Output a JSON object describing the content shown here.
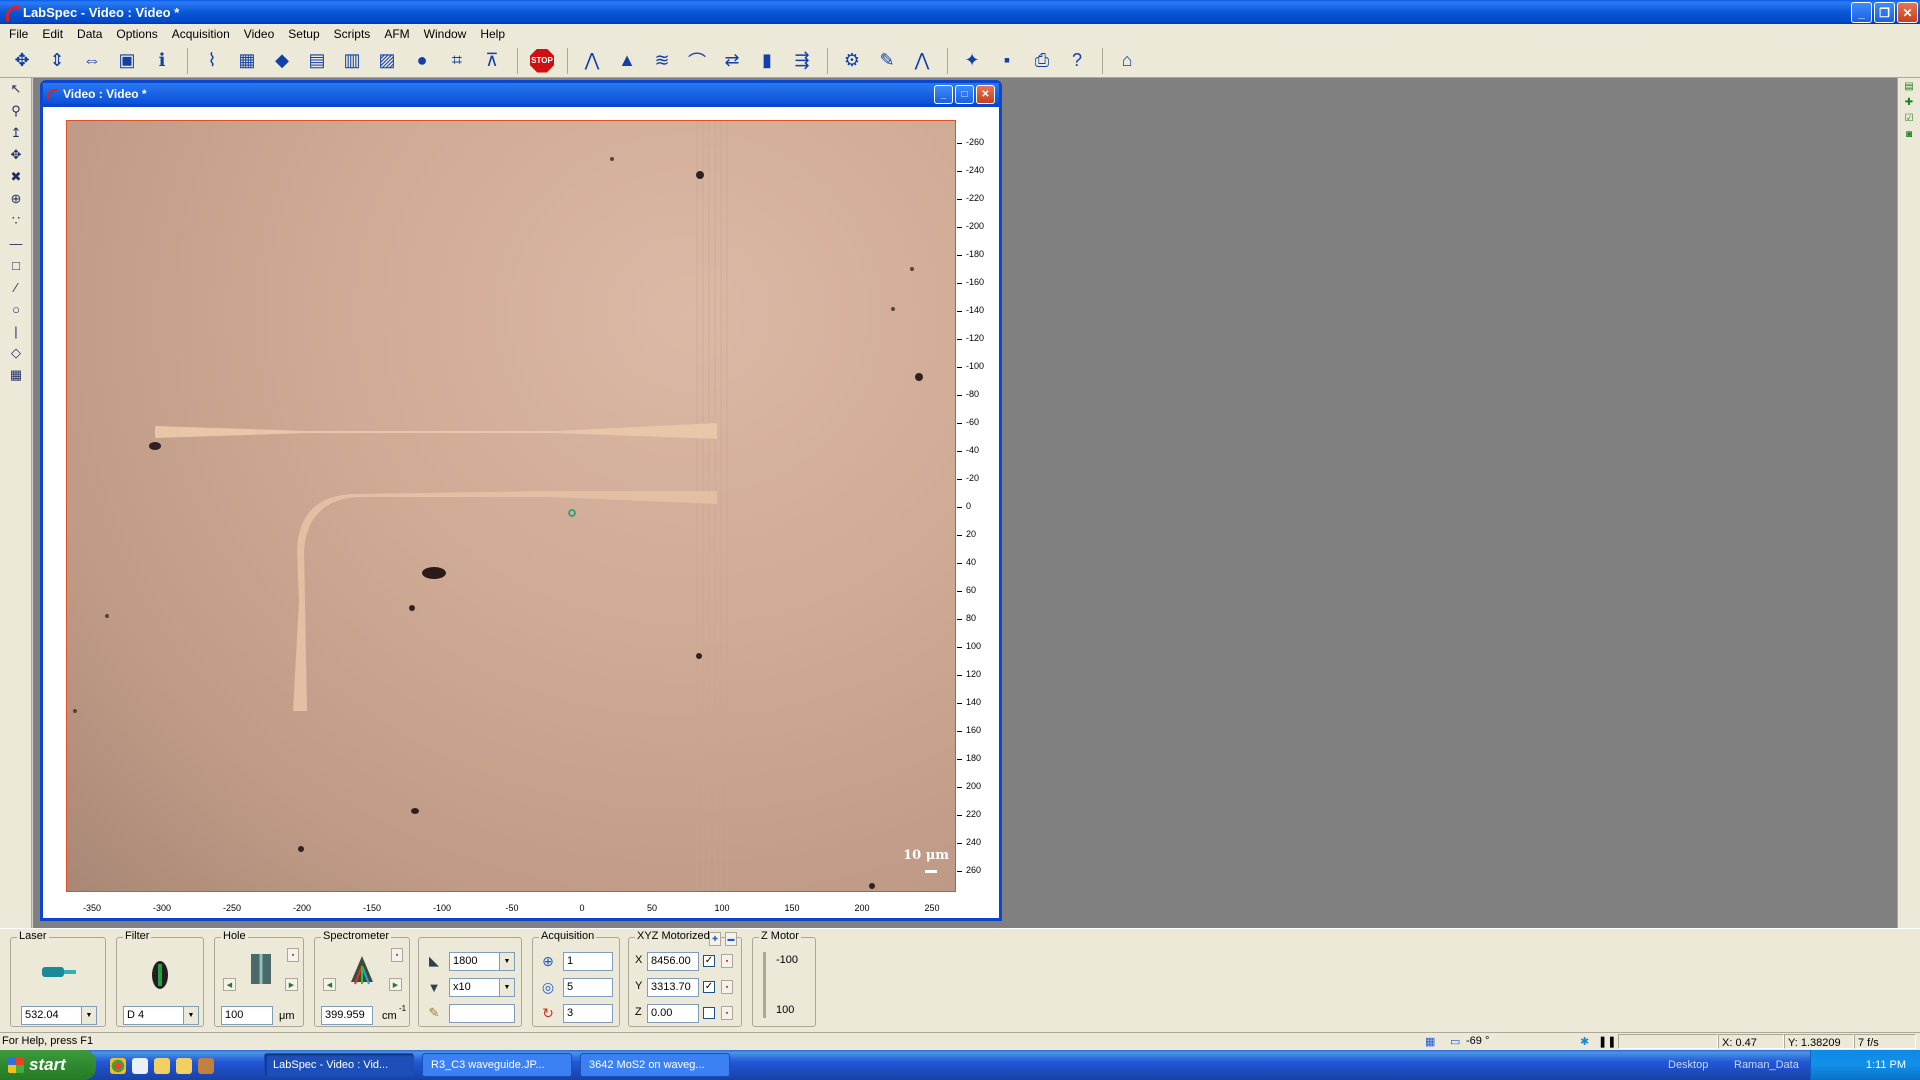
{
  "app": {
    "title": "LabSpec - Video : Video *"
  },
  "menu": [
    "File",
    "Edit",
    "Data",
    "Options",
    "Acquisition",
    "Video",
    "Setup",
    "Scripts",
    "AFM",
    "Window",
    "Help"
  ],
  "toolbar": {
    "icons": [
      "realtime-display-icon",
      "autofocus-icon",
      "extended-icon",
      "video-icon",
      "info-icon",
      "spectrum-acquire-icon",
      "map-icon",
      "multiwell-icon",
      "grid-icon",
      "grid2-icon",
      "image-icon",
      "sphere-icon",
      "frame-icon",
      "focus-point-icon"
    ],
    "stop_label": "STOP",
    "icons2": [
      "spectrum-icon",
      "peaks-icon",
      "baseline-icon",
      "fit-icon",
      "arrows-icon",
      "histogram-icon",
      "export-icon",
      "process-icon",
      "palette-icon",
      "overlay-icon",
      "open-icon",
      "save-icon",
      "print-icon",
      "help-icon",
      "basket-icon"
    ]
  },
  "video_window": {
    "title": "Video : Video *",
    "y_ticks": [
      "-260",
      "-240",
      "-220",
      "-200",
      "-180",
      "-160",
      "-140",
      "-120",
      "-100",
      "-80",
      "-60",
      "-40",
      "-20",
      "0",
      "20",
      "40",
      "60",
      "80",
      "100",
      "120",
      "140",
      "160",
      "180",
      "200",
      "220",
      "240",
      "260"
    ],
    "x_ticks": [
      "-350",
      "-300",
      "-250",
      "-200",
      "-150",
      "-100",
      "-50",
      "0",
      "50",
      "100",
      "150",
      "200",
      "250"
    ],
    "scale_label": "10 μm"
  },
  "controls": {
    "laser": {
      "legend": "Laser",
      "value": "532.04"
    },
    "filter": {
      "legend": "Filter",
      "value": "D 4"
    },
    "hole": {
      "legend": "Hole",
      "value": "100",
      "unit": "μm"
    },
    "spectrometer": {
      "legend": "Spectrometer",
      "value": "399.959",
      "unit": "cm",
      "unit_sup": "-1"
    },
    "grating": {
      "value": "1800"
    },
    "objective": {
      "value": "x10"
    },
    "extra": {
      "value": ""
    },
    "acquisition": {
      "legend": "Acquisition",
      "time": "1",
      "accum": "5",
      "repeat": "3"
    },
    "xyz": {
      "legend": "XYZ Motorized",
      "x_label": "X",
      "x": "8456.00",
      "y_label": "Y",
      "y": "3313.70",
      "z_label": "Z",
      "z": "0.00",
      "x_checked": "✓",
      "y_checked": "✓"
    },
    "zmotor": {
      "legend": "Z Motor",
      "top": "-100",
      "bottom": "100"
    }
  },
  "status": {
    "help": "For Help, press F1",
    "temp": "-69 °",
    "x": "X: 0.47",
    "y": "Y: 1.38209",
    "fps": "7 f/s"
  },
  "taskbar": {
    "start": "start",
    "tasks": [
      "LabSpec - Video : Vid...",
      "R3_C3 waveguide.JP...",
      "3642 MoS2 on waveg..."
    ],
    "desktop": "Desktop",
    "raman": "Raman_Data",
    "time": "1:11 PM"
  }
}
